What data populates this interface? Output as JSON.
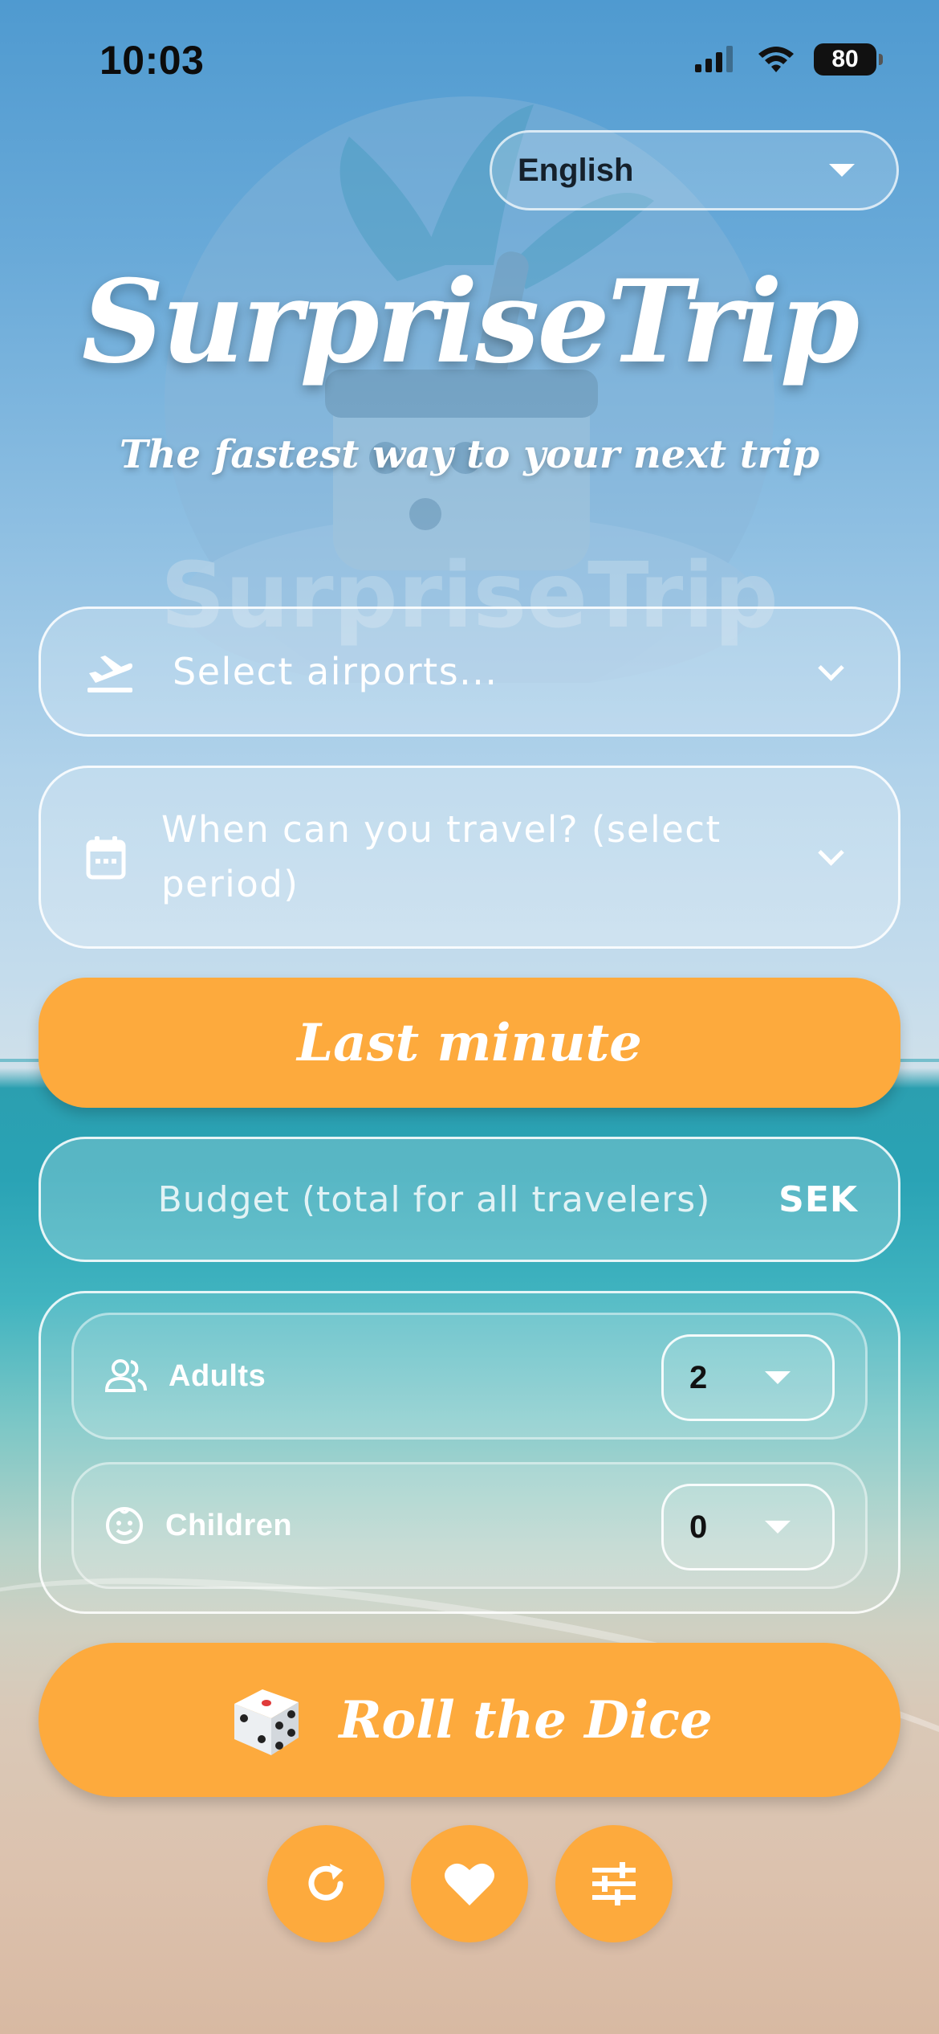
{
  "status_bar": {
    "time": "10:03",
    "battery": "80"
  },
  "watermark": {
    "text": "SurpriseTrip"
  },
  "language": {
    "selected": "English"
  },
  "header": {
    "title": "SurpriseTrip",
    "subtitle": "The fastest way to your next trip"
  },
  "airports": {
    "placeholder": "Select airports..."
  },
  "dates": {
    "placeholder": "When can you travel? (select period)"
  },
  "last_minute": {
    "label": "Last minute"
  },
  "budget": {
    "placeholder": "Budget (total for all travelers)",
    "currency": "SEK"
  },
  "travelers": {
    "adults": {
      "label": "Adults",
      "value": "2"
    },
    "children": {
      "label": "Children",
      "value": "0"
    }
  },
  "roll": {
    "label": "Roll the Dice"
  },
  "bottom_actions": [
    {
      "icon": "refresh-icon"
    },
    {
      "icon": "heart-icon"
    },
    {
      "icon": "filter-sliders-icon"
    }
  ],
  "colors": {
    "accent": "#fdaa3d",
    "sky": "#4f9ad0",
    "sea": "#2aa3b5",
    "sand": "#d8b9a2"
  }
}
